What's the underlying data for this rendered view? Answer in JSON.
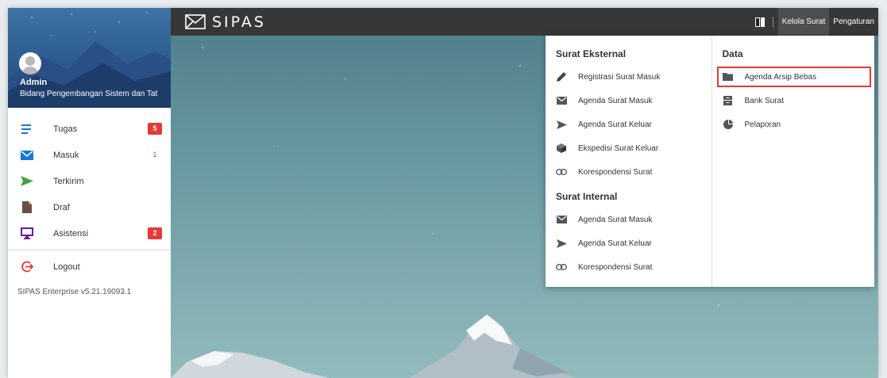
{
  "brand": {
    "name": "SIPAS"
  },
  "user": {
    "name": "Admin",
    "unit": "Bidang Pengembangan Sistem dan Tat"
  },
  "sidebar": {
    "items": [
      {
        "label": "Tugas",
        "badge": "5"
      },
      {
        "label": "Masuk",
        "badge": "1"
      },
      {
        "label": "Terkirim"
      },
      {
        "label": "Draf"
      },
      {
        "label": "Asistensi",
        "badge": "2"
      }
    ],
    "logout_label": "Logout",
    "version": "SIPAS Enterprise v5.21.19093.1"
  },
  "topbar": {
    "menu_kelola": "Kelola Surat",
    "menu_pengaturan": "Pengaturan"
  },
  "dropdown": {
    "external": {
      "heading": "Surat Eksternal",
      "items": [
        {
          "label": "Registrasi Surat Masuk",
          "icon": "pencil-icon"
        },
        {
          "label": "Agenda Surat Masuk",
          "icon": "envelope-icon"
        },
        {
          "label": "Agenda Surat Keluar",
          "icon": "send-icon"
        },
        {
          "label": "Ekspedisi Surat Keluar",
          "icon": "cube-icon"
        },
        {
          "label": "Korespondensi Surat",
          "icon": "link-icon"
        }
      ]
    },
    "internal": {
      "heading": "Surat Internal",
      "items": [
        {
          "label": "Agenda Surat Masuk",
          "icon": "envelope-icon"
        },
        {
          "label": "Agenda Surat Keluar",
          "icon": "send-icon"
        },
        {
          "label": "Korespondensi Surat",
          "icon": "link-icon"
        }
      ]
    },
    "data": {
      "heading": "Data",
      "items": [
        {
          "label": "Agenda Arsip Bebas",
          "icon": "folder-icon"
        },
        {
          "label": "Bank Surat",
          "icon": "archive-icon"
        },
        {
          "label": "Pelaporan",
          "icon": "pie-chart-icon"
        }
      ]
    }
  },
  "colors": {
    "topbar": "#373737",
    "badge": "#e53935",
    "accent_blue": "#1976d2",
    "accent_green": "#43a047",
    "accent_purple": "#6a1b9a"
  }
}
